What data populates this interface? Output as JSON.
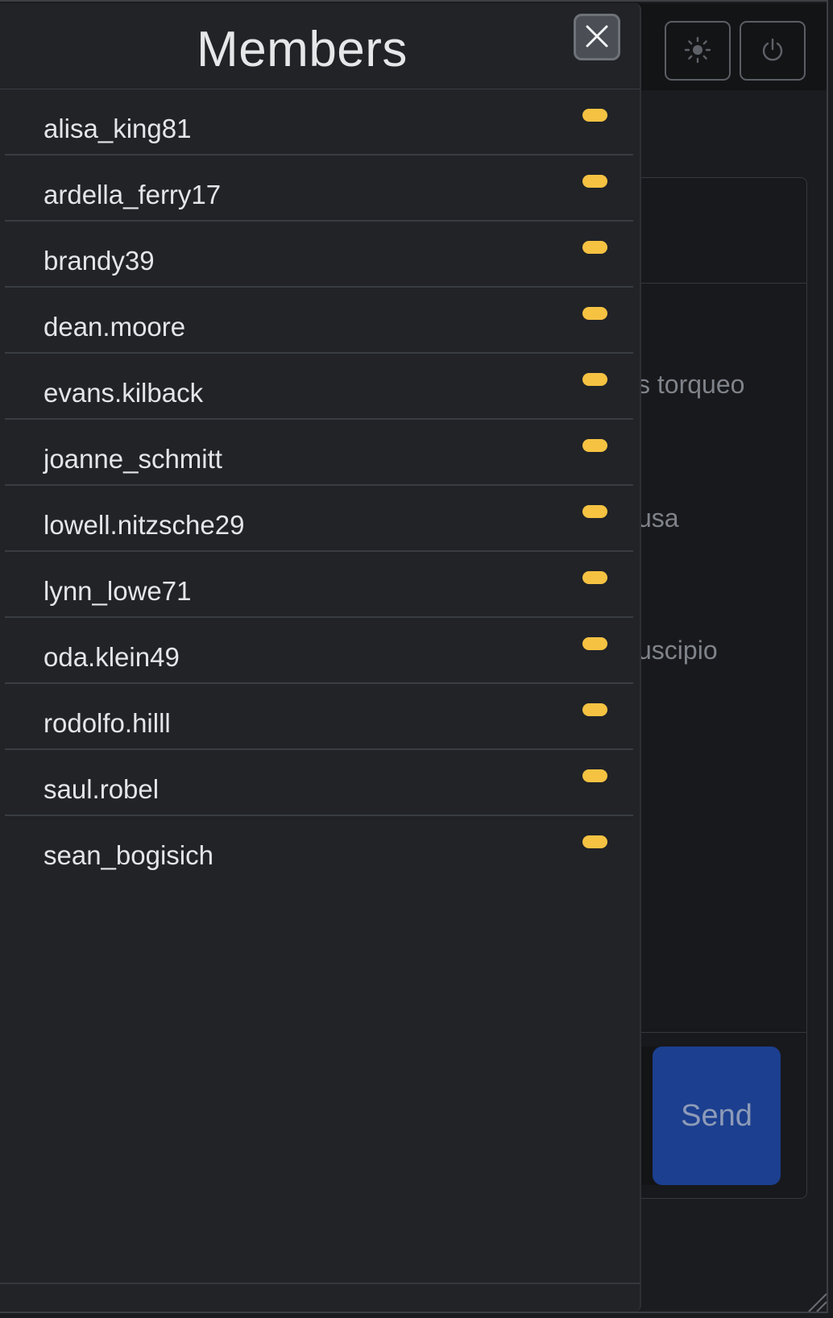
{
  "drawer": {
    "title": "Members",
    "close_icon": "close-icon"
  },
  "members": [
    {
      "username": "alisa_king81",
      "status_color": "#f5c242"
    },
    {
      "username": "ardella_ferry17",
      "status_color": "#f5c242"
    },
    {
      "username": "brandy39",
      "status_color": "#f5c242"
    },
    {
      "username": "dean.moore",
      "status_color": "#f5c242"
    },
    {
      "username": "evans.kilback",
      "status_color": "#f5c242"
    },
    {
      "username": "joanne_schmitt",
      "status_color": "#f5c242"
    },
    {
      "username": "lowell.nitzsche29",
      "status_color": "#f5c242"
    },
    {
      "username": "lynn_lowe71",
      "status_color": "#f5c242"
    },
    {
      "username": "oda.klein49",
      "status_color": "#f5c242"
    },
    {
      "username": "rodolfo.hilll",
      "status_color": "#f5c242"
    },
    {
      "username": "saul.robel",
      "status_color": "#f5c242"
    },
    {
      "username": "sean_bogisich",
      "status_color": "#f5c242"
    }
  ],
  "topbar": {
    "theme_icon": "sun-icon",
    "power_icon": "power-icon"
  },
  "chat": {
    "messages": [
      {
        "text_fragment": "s torqueo"
      },
      {
        "text_fragment": "usa"
      },
      {
        "text_fragment": "uscipio"
      }
    ],
    "send_label": "Send"
  },
  "colors": {
    "accent": "#1c3f8f",
    "status": "#f5c242",
    "drawer_bg": "#212327"
  }
}
